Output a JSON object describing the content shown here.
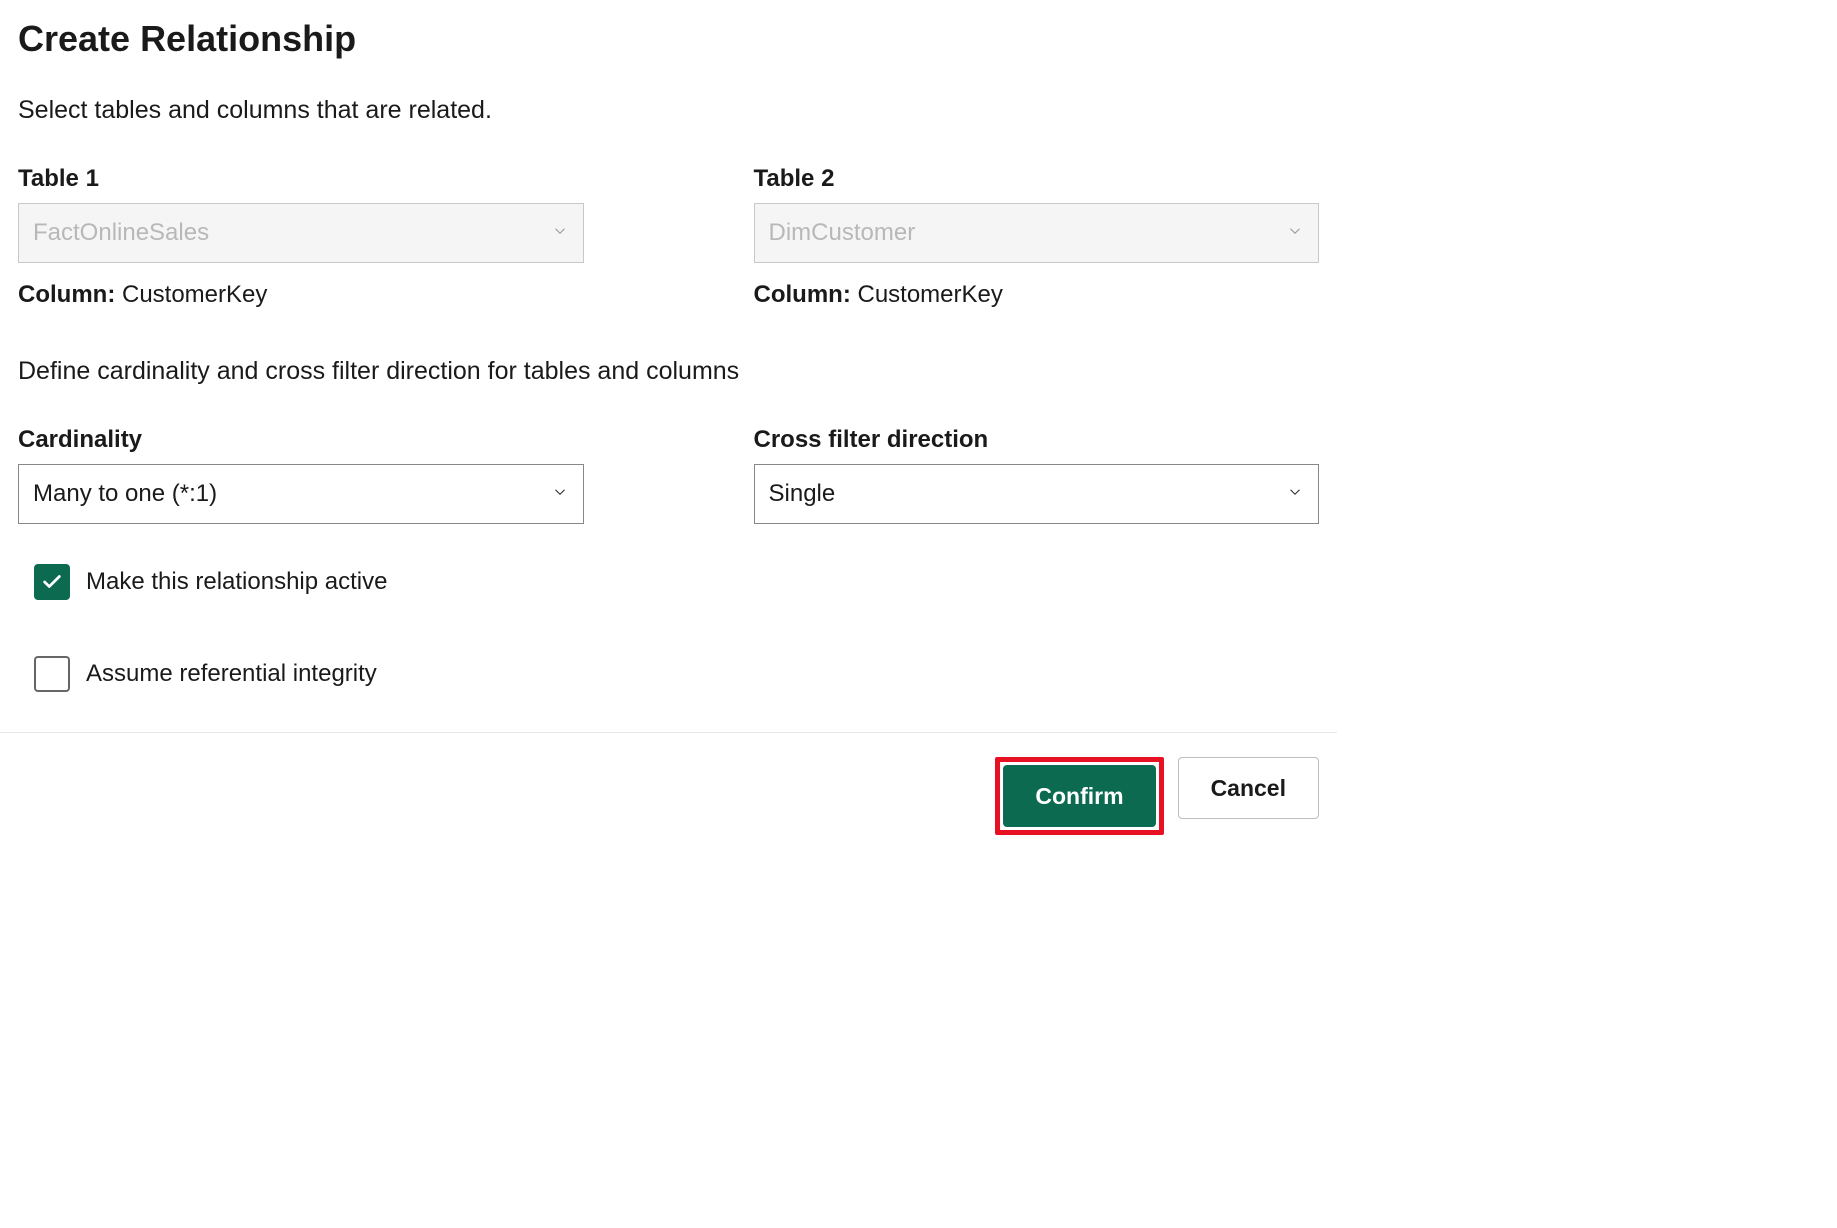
{
  "dialog": {
    "title": "Create Relationship",
    "subtitle": "Select tables and columns that are related."
  },
  "tables": {
    "left": {
      "label": "Table 1",
      "value": "FactOnlineSales",
      "column_prefix": "Column:",
      "column_value": "CustomerKey"
    },
    "right": {
      "label": "Table 2",
      "value": "DimCustomer",
      "column_prefix": "Column:",
      "column_value": "CustomerKey"
    }
  },
  "cardinality_section": {
    "description": "Define cardinality and cross filter direction for tables and columns",
    "cardinality_label": "Cardinality",
    "cardinality_value": "Many to one (*:1)",
    "crossfilter_label": "Cross filter direction",
    "crossfilter_value": "Single"
  },
  "checkboxes": {
    "active_label": "Make this relationship active",
    "active_checked": true,
    "integrity_label": "Assume referential integrity",
    "integrity_checked": false
  },
  "buttons": {
    "confirm": "Confirm",
    "cancel": "Cancel"
  }
}
